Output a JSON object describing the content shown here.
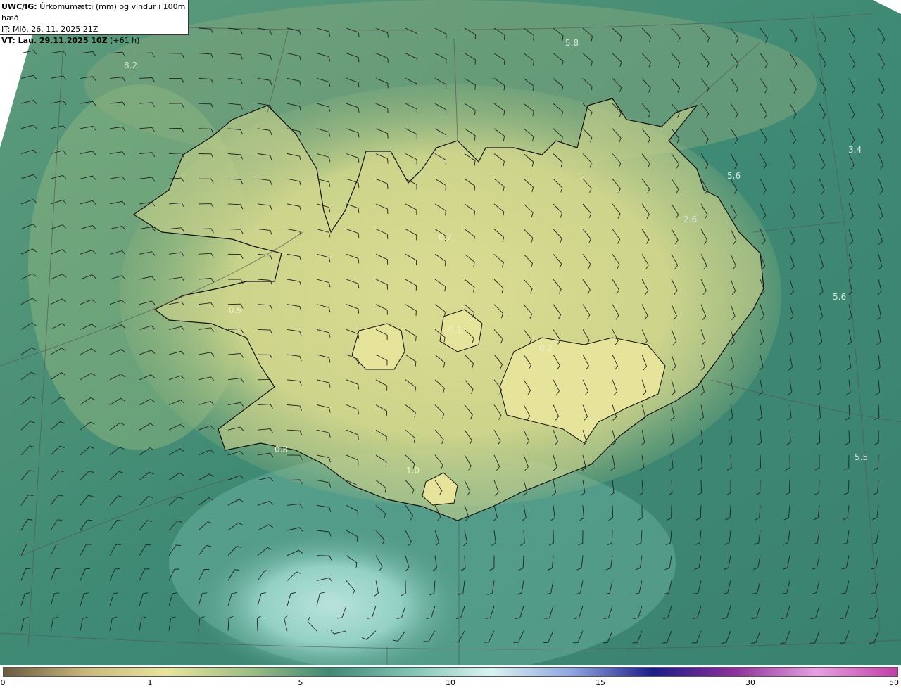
{
  "header": {
    "model_label": "UWC/IG:",
    "title": "Úrkomumætti (mm) og vindur i 100m hæð",
    "issue_time": "IT: Mið. 26. 11. 2025 21Z",
    "valid_prefix": "VT: Lau. 29.11.2025 10Z",
    "valid_offset": "(+61 h)"
  },
  "map": {
    "region": "Iceland",
    "field_labels": [
      "8.2",
      "5.8",
      "3.4",
      "5.6",
      "2.6",
      "5.6",
      "5.5",
      "0.7",
      "0.1",
      "0.2",
      "0.9",
      "0.8",
      "1.0"
    ],
    "colors": {
      "ocean": "#3f8a74",
      "ocean_light": "#7fc4b4",
      "ocean_cyan": "#bfeaea",
      "land_yellow": "#d8dc8c",
      "land_green": "#a9bc7b",
      "barb": "#222222",
      "coast": "#111111",
      "grid": "#555555"
    }
  },
  "colorbar": {
    "ticks": [
      "0",
      "1",
      "5",
      "10",
      "15",
      "30",
      "50"
    ],
    "stops": [
      "#6b5a3e",
      "#c9b77a",
      "#e8e59a",
      "#9fbf84",
      "#3f8a74",
      "#7fc4b4",
      "#d8f4f2",
      "#8fa5e0",
      "#1b1b8a",
      "#8e2f9c",
      "#e8a0e0",
      "#c23fa8"
    ]
  }
}
